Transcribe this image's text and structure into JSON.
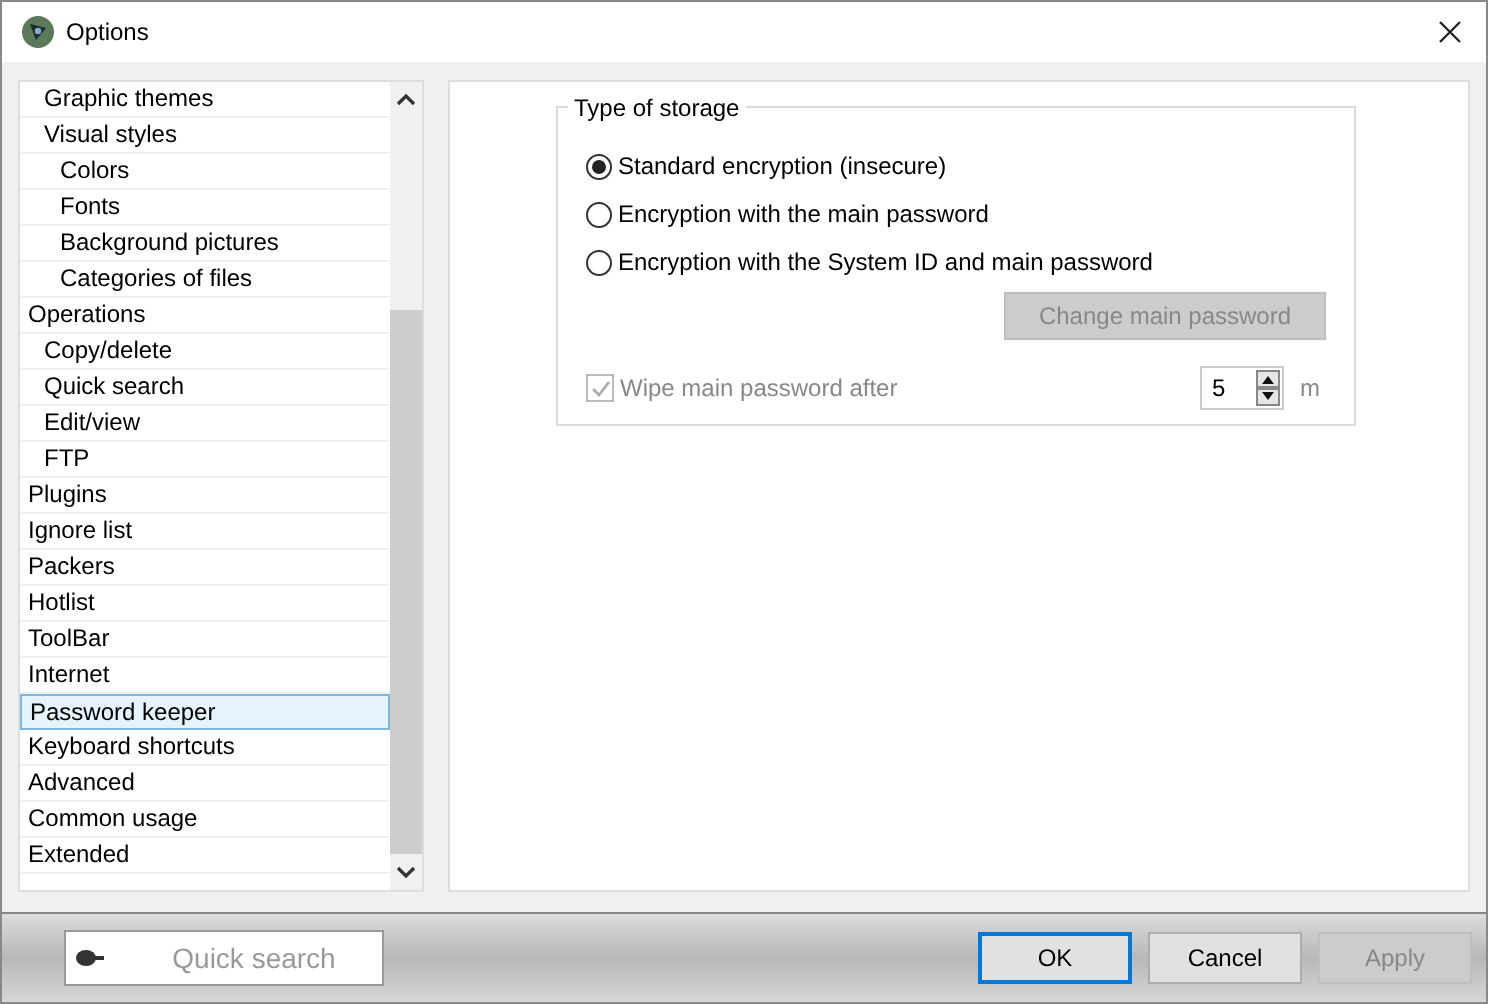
{
  "window": {
    "title": "Options"
  },
  "tree": [
    {
      "children": [
        {
          "label": "Graphic themes",
          "selected": false
        },
        {
          "label": "Visual styles",
          "selected": false,
          "children": [
            {
              "label": "Colors",
              "selected": false
            },
            {
              "label": "Fonts",
              "selected": false
            },
            {
              "label": "Background pictures",
              "selected": false
            },
            {
              "label": "Categories of files",
              "selected": false
            }
          ]
        }
      ]
    },
    {
      "label": "Operations",
      "selected": false,
      "children": [
        {
          "label": "Copy/delete",
          "selected": false
        },
        {
          "label": "Quick search",
          "selected": false
        },
        {
          "label": "Edit/view",
          "selected": false
        },
        {
          "label": "FTP",
          "selected": false
        }
      ]
    },
    {
      "label": "Plugins",
      "selected": false
    },
    {
      "label": "Ignore list",
      "selected": false
    },
    {
      "label": "Packers",
      "selected": false
    },
    {
      "label": "Hotlist",
      "selected": false
    },
    {
      "label": "ToolBar",
      "selected": false
    },
    {
      "label": "Internet",
      "selected": false
    },
    {
      "label": "Password keeper",
      "selected": true
    },
    {
      "label": "Keyboard shortcuts",
      "selected": false
    },
    {
      "label": "Advanced",
      "selected": false
    },
    {
      "label": "Common usage",
      "selected": false
    },
    {
      "label": "Extended",
      "selected": false
    }
  ],
  "storage": {
    "title": "Type of storage",
    "options": [
      {
        "label": "Standard encryption (insecure)",
        "selected": true
      },
      {
        "label": "Encryption with the main password",
        "selected": false
      },
      {
        "label": "Encryption with the System ID and main password",
        "selected": false
      }
    ],
    "change_button": {
      "label": "Change main password",
      "disabled": true
    },
    "wipe": {
      "label": "Wipe main password after",
      "checked": true,
      "disabled": true,
      "value": "5",
      "unit": "m"
    }
  },
  "quick_search": {
    "placeholder": "Quick search"
  },
  "buttons": [
    {
      "label": "OK",
      "disabled": false,
      "default": true
    },
    {
      "label": "Cancel",
      "disabled": false,
      "default": false
    },
    {
      "label": "Apply",
      "disabled": true,
      "default": false
    }
  ]
}
